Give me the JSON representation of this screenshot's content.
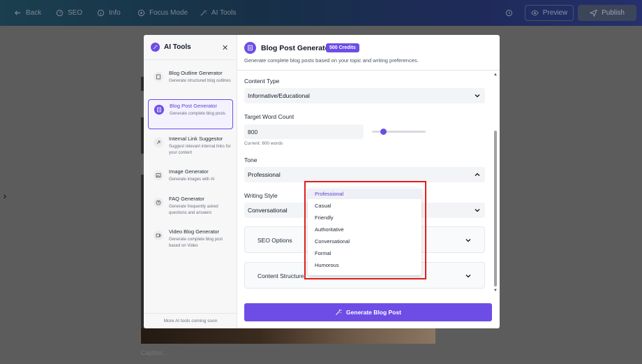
{
  "topbar": {
    "back": "Back",
    "seo": "SEO",
    "info": "Info",
    "focus_mode": "Focus Mode",
    "ai_tools": "AI Tools",
    "preview": "Preview",
    "publish": "Publish"
  },
  "editor": {
    "caption_placeholder": "Caption..."
  },
  "sidebar": {
    "title": "AI Tools",
    "items": [
      {
        "name": "Blog Outline Generator",
        "desc": "Generate structured blog outlines"
      },
      {
        "name": "Blog Post Generator",
        "desc": "Generate complete blog posts"
      },
      {
        "name": "Internal Link Suggestor",
        "desc": "Suggest relevant internal links for your content"
      },
      {
        "name": "Image Generator",
        "desc": "Generate images with AI"
      },
      {
        "name": "FAQ Generator",
        "desc": "Generate frequently asked questions and answers"
      },
      {
        "name": "Video Blog Generator",
        "desc": "Generate complete blog post based on Video"
      }
    ],
    "footer": "More AI tools coming soon"
  },
  "main": {
    "title": "Blog Post Generator",
    "credits": "500 Credits",
    "subtitle": "Generate complete blog posts based on your topic and writing preferences.",
    "content_type_label": "Content Type",
    "content_type_value": "Informative/Educational",
    "word_count_label": "Target Word Count",
    "word_count_value": "800",
    "word_count_hint": "Current: 800 words",
    "tone_label": "Tone",
    "tone_value": "Professional",
    "writing_style_label": "Writing Style",
    "writing_style_value": "Conversational",
    "seo_options": "SEO Options",
    "content_structure": "Content Structure",
    "generate_button": "Generate Blog Post"
  },
  "tone_dropdown": {
    "options": [
      "Professional",
      "Casual",
      "Friendly",
      "Authoritative",
      "Conversational",
      "Formal",
      "Humorous"
    ],
    "selected": "Professional"
  },
  "colors": {
    "accent": "#6d4de6",
    "highlight": "#e11d1d"
  }
}
